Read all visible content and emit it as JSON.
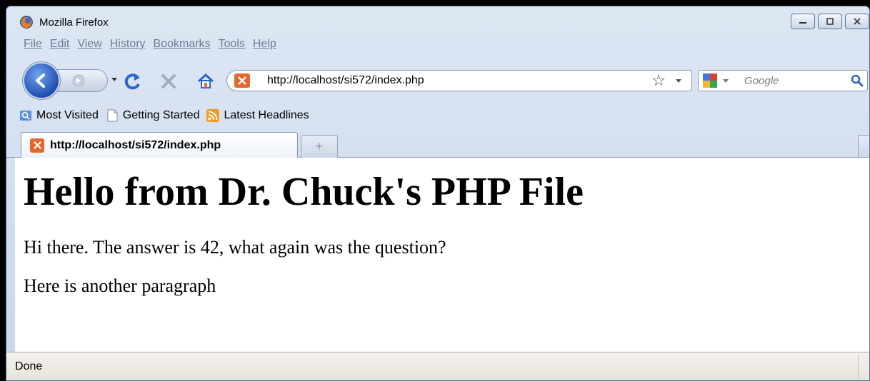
{
  "window": {
    "title": "Mozilla Firefox"
  },
  "menu": {
    "items": [
      "File",
      "Edit",
      "View",
      "History",
      "Bookmarks",
      "Tools",
      "Help"
    ]
  },
  "nav": {
    "url": "http://localhost/si572/index.php",
    "search_placeholder": "Google"
  },
  "bookmarks": {
    "items": [
      "Most Visited",
      "Getting Started",
      "Latest Headlines"
    ]
  },
  "tabs": [
    {
      "label": "http://localhost/si572/index.php",
      "active": true
    }
  ],
  "page": {
    "heading": "Hello from Dr. Chuck's PHP File",
    "paragraphs": [
      "Hi there. The answer is 42, what again was the question?",
      "Here is another paragraph"
    ]
  },
  "status": {
    "text": "Done"
  },
  "colors": {
    "accent": "#1f4fb0",
    "site_icon": "#e8662a",
    "rss": "#f39a1e"
  },
  "icons": {
    "app": "firefox-icon",
    "back": "back-arrow-icon",
    "forward": "forward-arrow-icon",
    "reload": "reload-icon",
    "stop": "stop-icon",
    "home": "home-icon",
    "star": "bookmark-star-icon",
    "search_engine": "google-icon",
    "search_go": "magnifier-icon",
    "site": "xampp-icon",
    "rss": "rss-icon",
    "page": "page-icon"
  }
}
